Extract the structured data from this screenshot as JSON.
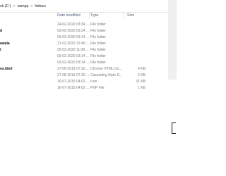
{
  "breadcrumb": {
    "items": [
      "sk (C:)",
      "xampp",
      "htdocs"
    ],
    "separator": ">"
  },
  "columns": {
    "date": "Date modified",
    "type": "Type",
    "size": "Size"
  },
  "rows": [
    {
      "name": "",
      "date": "24-02-2020 03:34 ...",
      "type": "File folder",
      "size": ""
    },
    {
      "name": "d",
      "date": "03-02-2020 03:34 ...",
      "type": "File folder",
      "size": ""
    },
    {
      "name": "",
      "date": "03-02-2020 03:14 ...",
      "type": "File folder",
      "size": ""
    },
    {
      "name": "awala",
      "date": "21-02-2020 12:49 ...",
      "type": "File folder",
      "size": ""
    },
    {
      "name": "t",
      "date": "20-02-2020 11:08 ...",
      "type": "File folder",
      "size": ""
    },
    {
      "name": "",
      "date": "03-02-2020 03:14 ...",
      "type": "File folder",
      "size": ""
    },
    {
      "name": "",
      "date": "03-02-2020 03:14 ...",
      "type": "File folder",
      "size": ""
    },
    {
      "name": "es.html",
      "date": "27-08-2019 07:32 ...",
      "type": "Chrome HTML Do...",
      "size": "4 KB"
    },
    {
      "name": "",
      "date": "27-08-2019 07:32 ...",
      "type": "Cascading Style S...",
      "size": "2 KB"
    },
    {
      "name": "",
      "date": "16-07-2015 04:02 ...",
      "type": "Icon",
      "size": "31 KB"
    },
    {
      "name": "",
      "date": "16-07-2015 04:02 ...",
      "type": "PHP File",
      "size": "1 KB"
    }
  ]
}
